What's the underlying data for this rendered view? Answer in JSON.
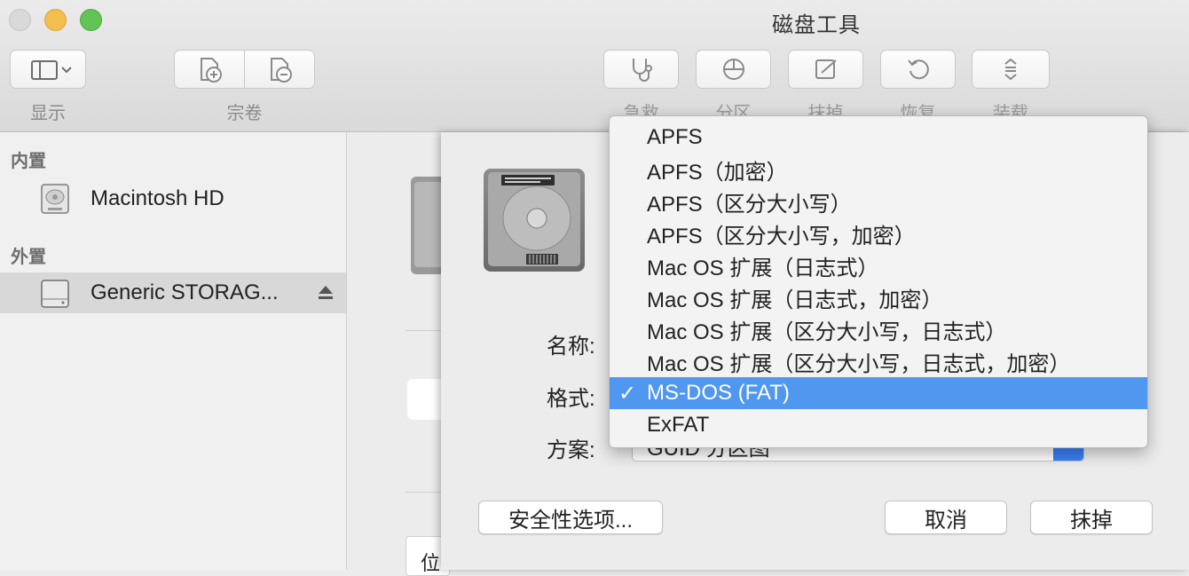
{
  "window": {
    "title": "磁盘工具"
  },
  "toolbar": {
    "show_label": "显示",
    "volume_label": "宗卷",
    "first_aid_label": "急救",
    "partition_label": "分区",
    "erase_label": "抹掉",
    "restore_label": "恢复",
    "mount_label": "装载"
  },
  "sidebar": {
    "internal_header": "内置",
    "external_header": "外置",
    "items": [
      {
        "label": "Macintosh HD"
      },
      {
        "label": "Generic STORAG..."
      }
    ]
  },
  "sheet": {
    "name_label": "名称:",
    "format_label": "格式:",
    "scheme_label": "方案:",
    "scheme_value": "GUID 分区图",
    "security_button": "安全性选项...",
    "cancel_button": "取消",
    "erase_button": "抹掉",
    "bottom_cut_text": "位"
  },
  "format_menu": {
    "items": [
      {
        "label": "APFS"
      },
      {
        "label": "APFS（加密）"
      },
      {
        "label": "APFS（区分大小写）"
      },
      {
        "label": "APFS（区分大小写，加密）"
      },
      {
        "label": "Mac OS 扩展（日志式）"
      },
      {
        "label": "Mac OS 扩展（日志式，加密）"
      },
      {
        "label": "Mac OS 扩展（区分大小写，日志式）"
      },
      {
        "label": "Mac OS 扩展（区分大小写，日志式，加密）"
      },
      {
        "label": "MS-DOS (FAT)",
        "check": "✓"
      },
      {
        "label": "ExFAT"
      }
    ],
    "selected_index": 8
  },
  "colors": {
    "highlight": "#4f97ef",
    "accent": "#3b7ff6"
  }
}
